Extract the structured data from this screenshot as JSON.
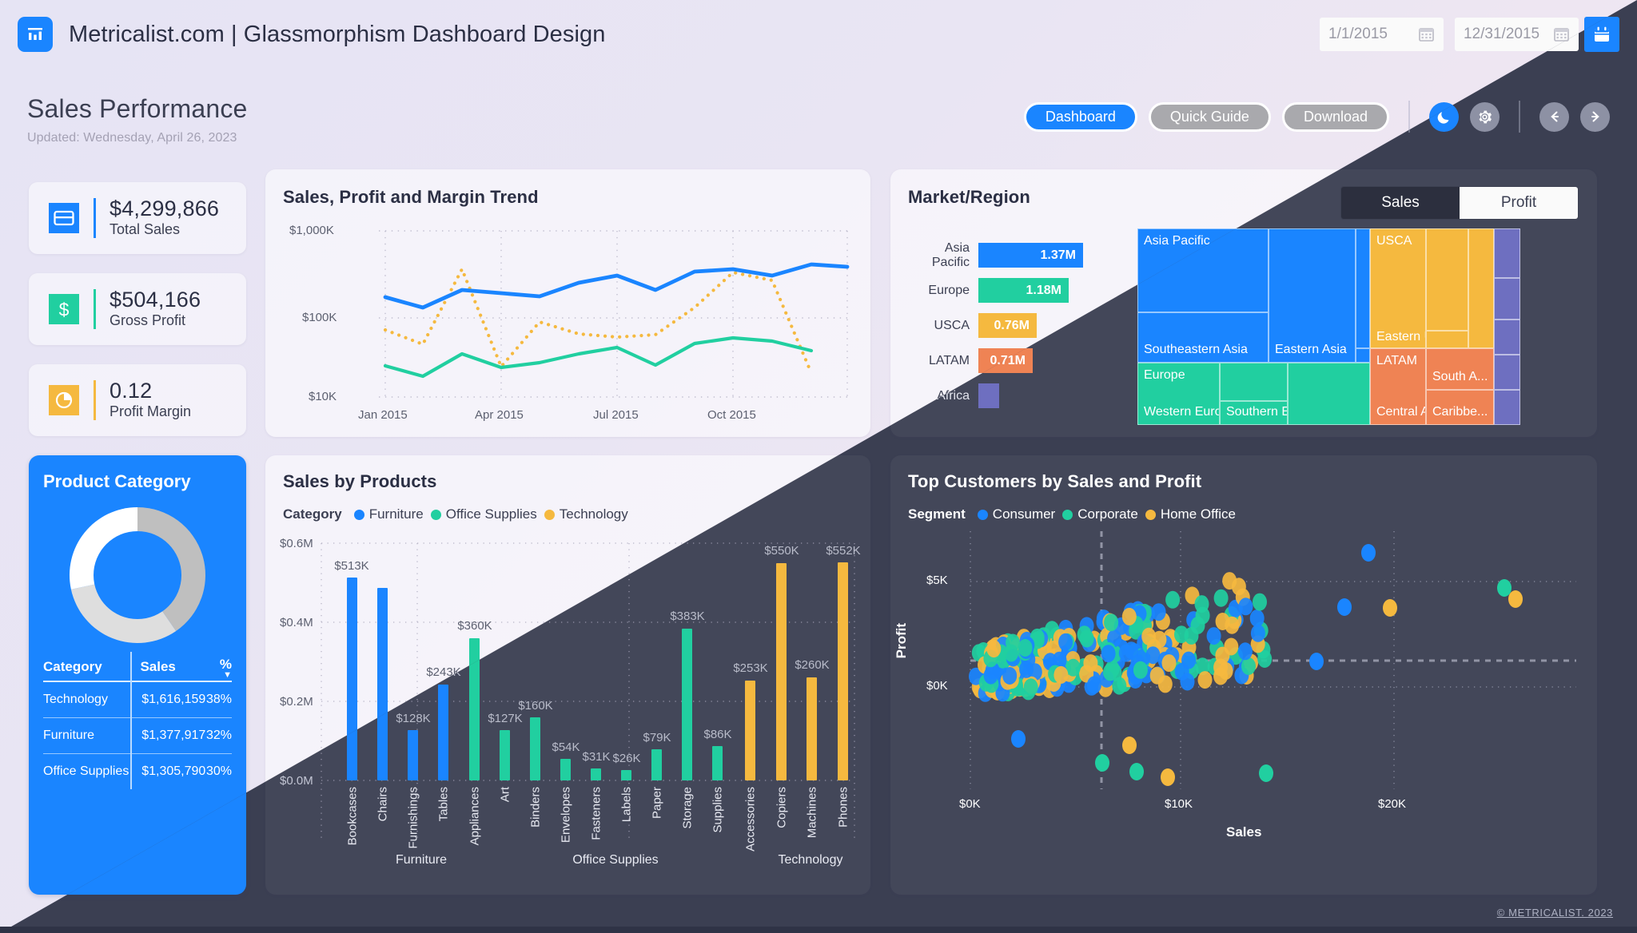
{
  "topbar": {
    "brand_title": "Metricalist.com | Glassmorphism Dashboard Design",
    "logo_icon": "bar-chart-icon",
    "date_from": "1/1/2015",
    "date_to": "12/31/2015",
    "calendar_icon": "calendar-icon",
    "calendar_button_icon": "calendar-icon"
  },
  "header": {
    "title": "Sales Performance",
    "updated": "Updated: Wednesday, April 26, 2023",
    "buttons": [
      {
        "label": "Dashboard",
        "state": "active"
      },
      {
        "label": "Quick Guide",
        "state": "muted"
      },
      {
        "label": "Download",
        "state": "muted"
      }
    ],
    "theme_icons": [
      "moon-icon",
      "gear-icon"
    ],
    "nav_icons": [
      "arrow-left-icon",
      "arrow-right-icon"
    ]
  },
  "kpis": [
    {
      "value": "$4,299,866",
      "label": "Total Sales",
      "color": "#1a85ff",
      "icon": "card-icon"
    },
    {
      "value": "$504,166",
      "label": "Gross Profit",
      "color": "#21cfa0",
      "icon": "dollar-icon"
    },
    {
      "value": "0.12",
      "label": "Profit Margin",
      "color": "#f5b93f",
      "icon": "pie-icon"
    }
  ],
  "trend_panel": {
    "title": "Sales, Profit and Margin Trend"
  },
  "market_panel": {
    "title": "Market/Region",
    "toggle": [
      {
        "label": "Sales",
        "selected": true
      },
      {
        "label": "Profit",
        "selected": false
      }
    ]
  },
  "product_category": {
    "title": "Product Category",
    "columns": [
      "Category",
      "Sales",
      "%"
    ],
    "sort_icon": "sort-desc-icon",
    "rows": [
      {
        "category": "Technology",
        "sales": "$1,616,159",
        "pct": "38%"
      },
      {
        "category": "Furniture",
        "sales": "$1,377,917",
        "pct": "32%"
      },
      {
        "category": "Office Supplies",
        "sales": "$1,305,790",
        "pct": "30%"
      }
    ]
  },
  "products_panel": {
    "title": "Sales by Products",
    "legend_key": "Category",
    "legend": [
      {
        "label": "Furniture",
        "color": "#1a85ff"
      },
      {
        "label": "Office Supplies",
        "color": "#21cfa0"
      },
      {
        "label": "Technology",
        "color": "#f5b93f"
      }
    ]
  },
  "customers_panel": {
    "title": "Top Customers by Sales and Profit",
    "legend_key": "Segment",
    "legend": [
      {
        "label": "Consumer",
        "color": "#1a85ff"
      },
      {
        "label": "Corporate",
        "color": "#21cfa0"
      },
      {
        "label": "Home Office",
        "color": "#f5b93f"
      }
    ]
  },
  "footer": {
    "copyright": "© METRICALIST. 2023"
  },
  "chart_data": [
    {
      "type": "line",
      "title": "Sales, Profit and Margin Trend",
      "xlabel": "",
      "ylabel": "",
      "scale": "log",
      "ylim": [
        10000,
        1000000
      ],
      "ytick_labels": [
        "$10K",
        "$100K",
        "$1,000K"
      ],
      "xtick_labels": [
        "Jan 2015",
        "Apr 2015",
        "Jul 2015",
        "Oct 2015"
      ],
      "x": [
        "Jan 2015",
        "Feb 2015",
        "Mar 2015",
        "Apr 2015",
        "May 2015",
        "Jun 2015",
        "Jul 2015",
        "Aug 2015",
        "Sep 2015",
        "Oct 2015",
        "Nov 2015",
        "Dec 2015"
      ],
      "series": [
        {
          "name": "Sales",
          "color": "#1a85ff",
          "style": "solid",
          "values": [
            265000,
            215000,
            295000,
            275000,
            265000,
            330000,
            380000,
            300000,
            420000,
            445000,
            400000,
            490000
          ]
        },
        {
          "name": "Profit",
          "color": "#21cfa0",
          "style": "solid",
          "values": [
            35000,
            26000,
            52000,
            35000,
            39000,
            52000,
            64000,
            36000,
            70000,
            82000,
            73000,
            74000
          ]
        },
        {
          "name": "Margin",
          "color": "#f5b93f",
          "style": "dotted",
          "values": [
            70000,
            46000,
            290000,
            36000,
            90000,
            66000,
            62000,
            68000,
            130000,
            305000,
            255000,
            30000
          ]
        }
      ]
    },
    {
      "type": "bar",
      "title": "Market/Region",
      "orientation": "horizontal",
      "categories": [
        "Asia Pacific",
        "Europe",
        "USCA",
        "LATAM",
        "Africa"
      ],
      "value_labels": [
        "1.37M",
        "1.18M",
        "0.76M",
        "0.71M",
        ""
      ],
      "values": [
        1.37,
        1.18,
        0.76,
        0.71,
        0.08
      ],
      "colors": [
        "#1a85ff",
        "#21cfa0",
        "#f5b93f",
        "#ef8354",
        "#6e6fc0"
      ]
    },
    {
      "type": "treemap",
      "title": "Market/Region Treemap",
      "nodes": [
        {
          "label": "Asia Pacific",
          "color": "#1a85ff",
          "group": "Asia Pacific"
        },
        {
          "label": "Southeastern Asia",
          "color": "#1a85ff",
          "group": "Asia Pacific"
        },
        {
          "label": "Eastern Asia",
          "color": "#1a85ff",
          "group": "Asia Pacific"
        },
        {
          "label": "Europe",
          "color": "#21cfa0",
          "group": "Europe"
        },
        {
          "label": "Western Europe",
          "color": "#21cfa0",
          "group": "Europe"
        },
        {
          "label": "Southern Euro...",
          "color": "#21cfa0",
          "group": "Europe"
        },
        {
          "label": "USCA",
          "color": "#f5b93f",
          "group": "USCA"
        },
        {
          "label": "Eastern US",
          "color": "#f5b93f",
          "group": "USCA"
        },
        {
          "label": "LATAM",
          "color": "#ef8354",
          "group": "LATAM"
        },
        {
          "label": "Central Am...",
          "color": "#ef8354",
          "group": "LATAM"
        },
        {
          "label": "Caribbe...",
          "color": "#ef8354",
          "group": "LATAM"
        },
        {
          "label": "South A...",
          "color": "#ef8354",
          "group": "LATAM"
        },
        {
          "label": "Africa",
          "color": "#6e6fc0",
          "group": "Africa"
        }
      ]
    },
    {
      "type": "pie",
      "title": "Product Category",
      "variant": "donut",
      "labels": [
        "Technology",
        "Furniture",
        "Office Supplies"
      ],
      "values": [
        38,
        32,
        30
      ],
      "value_text": [
        "$1,616,159",
        "$1,377,917",
        "$1,305,790"
      ],
      "colors": [
        "#bfbfbf",
        "#dedede",
        "#ffffff"
      ]
    },
    {
      "type": "bar",
      "title": "Sales by Products",
      "ylabel": "",
      "ylim": [
        0,
        0.6
      ],
      "ytick_labels": [
        "$0.0M",
        "$0.2M",
        "$0.4M",
        "$0.6M"
      ],
      "groups": [
        "Furniture",
        "Office Supplies",
        "Technology"
      ],
      "categories": [
        "Bookcases",
        "Chairs",
        "Furnishings",
        "Tables",
        "Appliances",
        "Art",
        "Binders",
        "Envelopes",
        "Fasteners",
        "Labels",
        "Paper",
        "Storage",
        "Supplies",
        "Accessories",
        "Copiers",
        "Machines",
        "Phones"
      ],
      "group_of": [
        "Furniture",
        "Furniture",
        "Furniture",
        "Furniture",
        "Office Supplies",
        "Office Supplies",
        "Office Supplies",
        "Office Supplies",
        "Office Supplies",
        "Office Supplies",
        "Office Supplies",
        "Office Supplies",
        "Office Supplies",
        "Technology",
        "Technology",
        "Technology",
        "Technology"
      ],
      "values": [
        513,
        487,
        128,
        243,
        360,
        127,
        160,
        54,
        31,
        26,
        79,
        383,
        86,
        253,
        550,
        260,
        552
      ],
      "value_labels": [
        "$513K",
        "",
        "$128K",
        "$243K",
        "$360K",
        "$127K",
        "$160K",
        "$54K",
        "$31K",
        "$26K",
        "$79K",
        "$383K",
        "$86K",
        "$253K",
        "$550K",
        "$260K",
        "$552K"
      ],
      "colors": {
        "Furniture": "#1a85ff",
        "Office Supplies": "#21cfa0",
        "Technology": "#f5b93f"
      }
    },
    {
      "type": "scatter",
      "title": "Top Customers by Sales and Profit",
      "xlabel": "Sales",
      "ylabel": "Profit",
      "xtick_labels": [
        "$0K",
        "$10K",
        "$20K"
      ],
      "ytick_labels": [
        "$0K",
        "$5K"
      ],
      "xlim": [
        0,
        24000
      ],
      "ylim": [
        -2500,
        8000
      ],
      "reference_lines": {
        "x": 5200,
        "y": 500
      },
      "series": [
        {
          "name": "Consumer",
          "color": "#1a85ff"
        },
        {
          "name": "Corporate",
          "color": "#21cfa0"
        },
        {
          "name": "Home Office",
          "color": "#f5b93f"
        }
      ]
    }
  ]
}
